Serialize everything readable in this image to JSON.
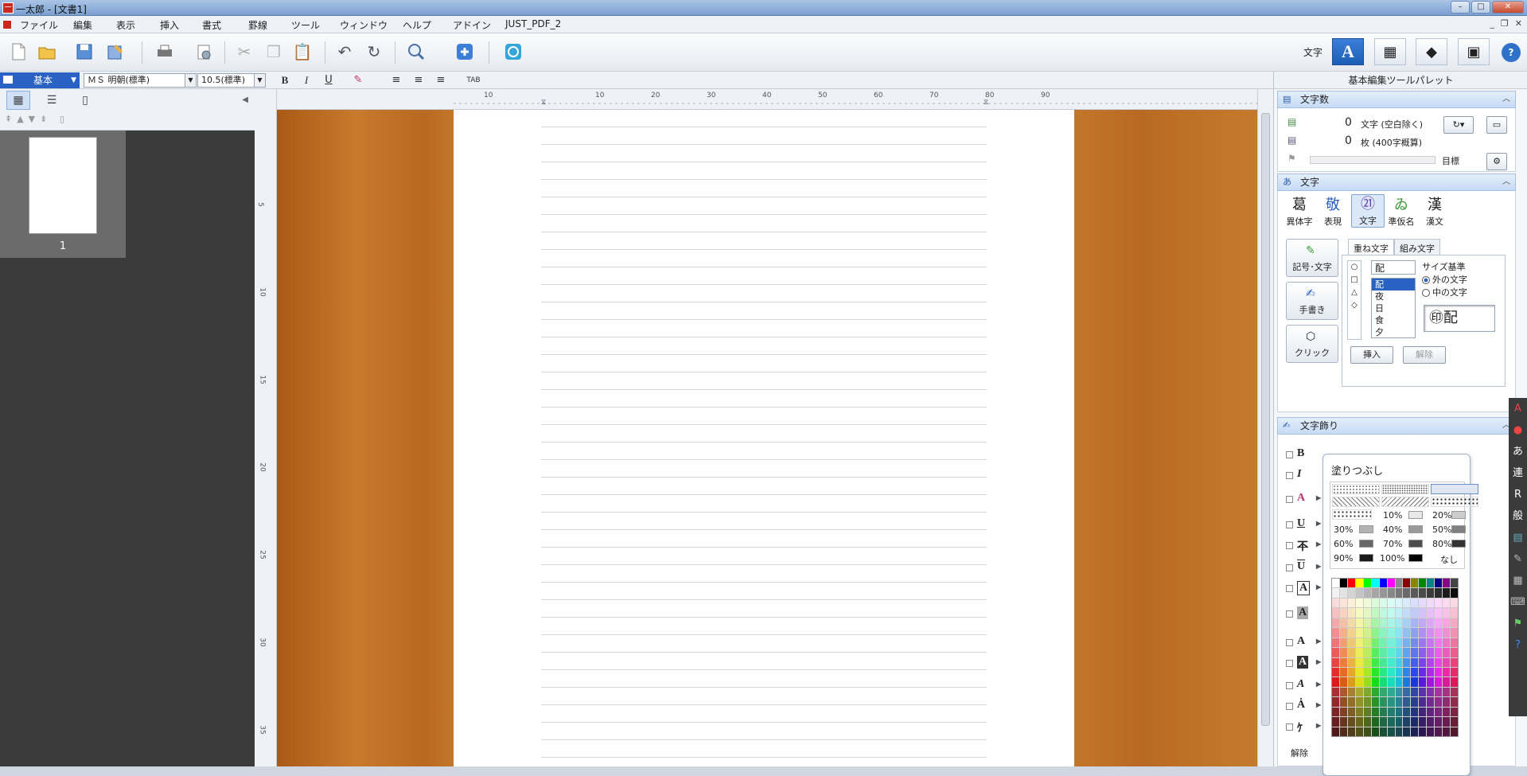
{
  "window": {
    "title": "一太郎 - [文書1]",
    "app_icon": "一"
  },
  "menu": [
    "ファイル",
    "編集",
    "表示",
    "挿入",
    "書式",
    "罫線",
    "ツール",
    "ウィンドウ",
    "ヘルプ",
    "アドイン",
    "JUST_PDF_2"
  ],
  "mode": {
    "label": "文字"
  },
  "format": {
    "style": "基本",
    "font": "ＭＳ 明朝(標準)",
    "size": "10.5(標準)",
    "bold": "B",
    "italic": "I",
    "underline": "U",
    "tab": "TAB"
  },
  "thumbs": {
    "page_number": "1"
  },
  "ruler": {
    "h_ticks": [
      "10",
      "10",
      "20",
      "30",
      "40",
      "50",
      "60",
      "70",
      "80",
      "90"
    ],
    "v_ticks": [
      "5",
      "10",
      "15",
      "20",
      "25",
      "30",
      "35"
    ]
  },
  "palette": {
    "title": "基本編集ツールパレット",
    "char_count": {
      "header": "文字数",
      "chars_value": "0",
      "chars_label": "文字 (空白除く)",
      "pages_value": "0",
      "pages_label": "枚 (400字概算)",
      "goal_label": "目標"
    },
    "char_section": {
      "header": "文字",
      "tools": [
        {
          "glyph": "葛",
          "label": "異体字"
        },
        {
          "glyph": "敬",
          "label": "表現"
        },
        {
          "glyph": "㉑",
          "label": "文字"
        },
        {
          "glyph": "ゐ",
          "label": "準仮名"
        },
        {
          "glyph": "漢",
          "label": "漢文"
        }
      ],
      "buttons": [
        "記号･文字",
        "手書き",
        "クリック"
      ],
      "tabs": [
        "重ね文字",
        "組み文字"
      ],
      "input_value": "配",
      "list_items": [
        "配",
        "夜",
        "日",
        "食",
        "夕"
      ],
      "size_basis": "サイズ基準",
      "outer": "外の文字",
      "inner": "中の文字",
      "preview": "㊞配",
      "insert": "挿入",
      "release": "解除"
    },
    "deco": {
      "header": "文字飾り",
      "fill_title": "塗りつぶし",
      "percents": [
        "10%",
        "20%",
        "30%",
        "40%",
        "50%",
        "60%",
        "70%",
        "80%",
        "90%",
        "100%",
        "なし"
      ],
      "release": "解除"
    }
  },
  "right_strip": [
    "あ",
    "連",
    "R",
    "般"
  ],
  "colors": {
    "accent": "#2a62c4",
    "wood": "#c07428"
  }
}
